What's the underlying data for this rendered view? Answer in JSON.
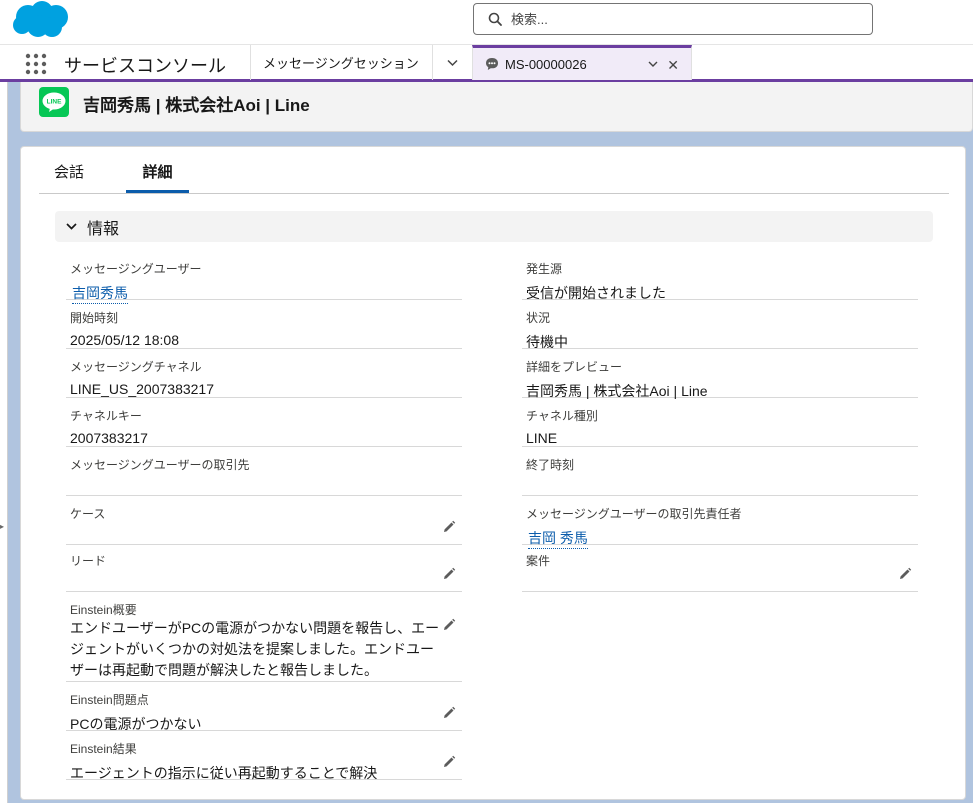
{
  "search": {
    "placeholder": "検索..."
  },
  "nav": {
    "app_name": "サービスコンソール",
    "tabs": [
      {
        "label": "メッセージングセッション"
      },
      {
        "label": "MS-00000026"
      }
    ],
    "close_glyph": "✕"
  },
  "record": {
    "title": "吉岡秀馬 | 株式会社Aoi | Line",
    "icon_text": "LINE"
  },
  "detail_tabs": [
    {
      "label": "会話"
    },
    {
      "label": "詳細"
    }
  ],
  "section": {
    "title": "情報"
  },
  "fields_left": [
    {
      "label": "メッセージングユーザー",
      "value": "吉岡秀馬"
    },
    {
      "label": "開始時刻",
      "value": "2025/05/12 18:08"
    },
    {
      "label": "メッセージングチャネル",
      "value": "LINE_US_2007383217"
    },
    {
      "label": "チャネルキー",
      "value": "2007383217"
    },
    {
      "label": "メッセージングユーザーの取引先",
      "value": ""
    },
    {
      "label": "ケース",
      "value": ""
    },
    {
      "label": "リード",
      "value": ""
    },
    {
      "label": "Einstein概要",
      "value": "エンドユーザーがPCの電源がつかない問題を報告し、エージェントがいくつかの対処法を提案しました。エンドユーザーは再起動で問題が解決したと報告しました。"
    },
    {
      "label": "Einstein問題点",
      "value": "PCの電源がつかない"
    },
    {
      "label": "Einstein結果",
      "value": "エージェントの指示に従い再起動することで解決"
    }
  ],
  "fields_right": [
    {
      "label": "発生源",
      "value": "受信が開始されました"
    },
    {
      "label": "状況",
      "value": "待機中"
    },
    {
      "label": "詳細をプレビュー",
      "value": "吉岡秀馬 | 株式会社Aoi | Line"
    },
    {
      "label": "チャネル種別",
      "value": "LINE"
    },
    {
      "label": "終了時刻",
      "value": ""
    },
    {
      "label": "メッセージングユーザーの取引先責任者",
      "value": "吉岡 秀馬"
    },
    {
      "label": "案件",
      "value": ""
    }
  ],
  "colors": {
    "brand": "#00a1e0",
    "accent": "#6b3ea0",
    "link": "#0b5cab",
    "line_green": "#06c755"
  }
}
